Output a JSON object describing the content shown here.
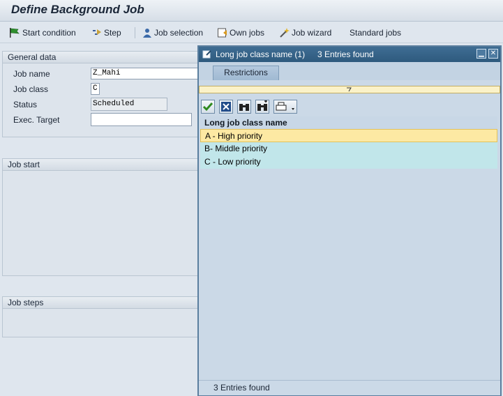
{
  "window": {
    "title": "Define Background Job"
  },
  "toolbar": [
    {
      "label": "Start condition",
      "icon": "flag-icon"
    },
    {
      "label": "Step",
      "icon": "step-icon"
    },
    {
      "label": "Job selection",
      "icon": "person-icon"
    },
    {
      "label": "Own jobs",
      "icon": "own-jobs-icon"
    },
    {
      "label": "Job wizard",
      "icon": "wand-icon"
    },
    {
      "label": "Standard jobs",
      "icon": ""
    }
  ],
  "general": {
    "heading": "General data",
    "job_name_label": "Job name",
    "job_name": "Z_Mahi",
    "job_class_label": "Job class",
    "job_class": "C",
    "status_label": "Status",
    "status": "Scheduled",
    "exec_target_label": "Exec. Target",
    "exec_target": ""
  },
  "job_start": {
    "heading": "Job start"
  },
  "job_steps": {
    "heading": "Job steps"
  },
  "dialog": {
    "title": "Long job class name (1)",
    "count": "3 Entries found",
    "tab": "Restrictions",
    "column": "Long job class name",
    "rows": [
      "A - High priority",
      "B-  Middle priority",
      "C - Low priority"
    ],
    "status": "3 Entries found"
  },
  "colors": {
    "title_bar": "#2e5a7e",
    "selected_row": "#fde9a3",
    "alt_row": "#c1e6ea"
  }
}
